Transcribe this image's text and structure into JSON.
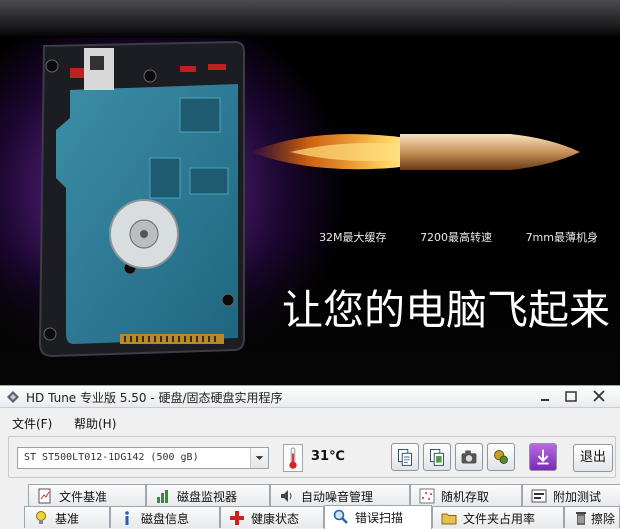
{
  "banner": {
    "features": [
      "32M最大缓存",
      "7200最高转速",
      "7mm最薄机身"
    ],
    "slogan": "让您的电脑飞起来"
  },
  "window": {
    "title": "HD Tune 专业版 5.50 - 硬盘/固态硬盘实用程序",
    "controls": [
      "minimize",
      "maximize",
      "close"
    ]
  },
  "menu": [
    "文件(F)",
    "帮助(H)"
  ],
  "toolbar": {
    "drive": "ST      ST500LT012-1DG142 (500 gB)",
    "temperature": "31℃",
    "exit_label": "退出",
    "icons": [
      "copy-text-icon",
      "copy-info-icon",
      "screenshot-icon",
      "options-icon",
      "download-icon"
    ]
  },
  "tabs_row1": [
    {
      "label": "文件基准",
      "icon": "file-benchmark-icon"
    },
    {
      "label": "磁盘监视器",
      "icon": "disk-monitor-icon"
    },
    {
      "label": "自动噪音管理",
      "icon": "speaker-icon"
    },
    {
      "label": "随机存取",
      "icon": "random-access-icon"
    },
    {
      "label": "附加测试",
      "icon": "extra-tests-icon"
    }
  ],
  "tabs_row2": [
    {
      "label": "基准",
      "icon": "benchmark-icon"
    },
    {
      "label": "磁盘信息",
      "icon": "info-icon"
    },
    {
      "label": "健康状态",
      "icon": "health-icon"
    },
    {
      "label": "错误扫描",
      "icon": "error-scan-icon",
      "active": true
    },
    {
      "label": "文件夹占用率",
      "icon": "folder-usage-icon"
    },
    {
      "label": "擦除",
      "icon": "erase-icon"
    }
  ],
  "colors": {
    "accent_purple": "#8a3cd0",
    "flame": "#ff8a1c",
    "active_tab": "#ffffff"
  }
}
